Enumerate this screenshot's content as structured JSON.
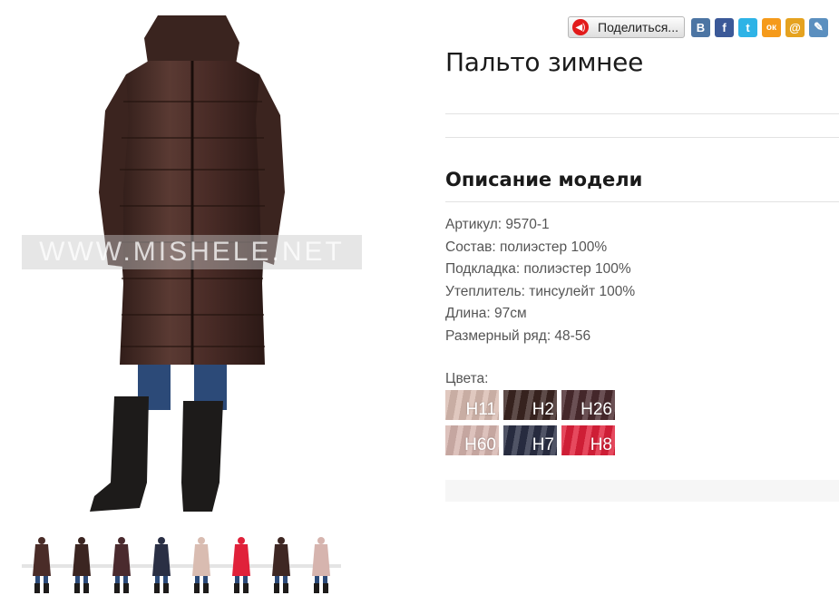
{
  "product": {
    "title": "Пальто зимнее",
    "watermark": "WWW.MISHELE.NET",
    "section_title": "Описание модели",
    "specs": [
      "Артикул: 9570-1",
      "Состав: полиэстер 100%",
      "Подкладка: полиэстер 100%",
      "Утеплитель: тинсулейт 100%",
      "Длина: 97см",
      "Размерный ряд: 48-56"
    ],
    "colors_label": "Цвета:",
    "colors": [
      {
        "code": "H11",
        "color": "#d9bcb1"
      },
      {
        "code": "H2",
        "color": "#3b2521"
      },
      {
        "code": "H26",
        "color": "#4a2a2e"
      },
      {
        "code": "H60",
        "color": "#d6b4ae"
      },
      {
        "code": "H7",
        "color": "#2a2f44"
      },
      {
        "code": "H8",
        "color": "#e0213a"
      }
    ]
  },
  "share": {
    "button_label": "Поделиться...",
    "networks": [
      {
        "name": "vkontakte-icon",
        "glyph": "В",
        "color": "#4c75a3"
      },
      {
        "name": "facebook-icon",
        "glyph": "f",
        "color": "#3b5998"
      },
      {
        "name": "twitter-icon",
        "glyph": "t",
        "color": "#2eb3e6"
      },
      {
        "name": "odnoklassniki-icon",
        "glyph": "ок",
        "color": "#f59a1b"
      },
      {
        "name": "mailru-icon",
        "glyph": "@",
        "color": "#e5a21f"
      },
      {
        "name": "livejournal-icon",
        "glyph": "✎",
        "color": "#5b8fbf"
      }
    ]
  },
  "thumbnails": [
    {
      "name": "thumb-1",
      "coat": "#4a2c28"
    },
    {
      "name": "thumb-2",
      "coat": "#3b2521"
    },
    {
      "name": "thumb-3",
      "coat": "#4a2a2e"
    },
    {
      "name": "thumb-4",
      "coat": "#2a2f44"
    },
    {
      "name": "thumb-5",
      "coat": "#d9bcb1"
    },
    {
      "name": "thumb-6",
      "coat": "#e0213a"
    },
    {
      "name": "thumb-7",
      "coat": "#3e2723"
    },
    {
      "name": "thumb-8",
      "coat": "#d6b4ae"
    }
  ]
}
